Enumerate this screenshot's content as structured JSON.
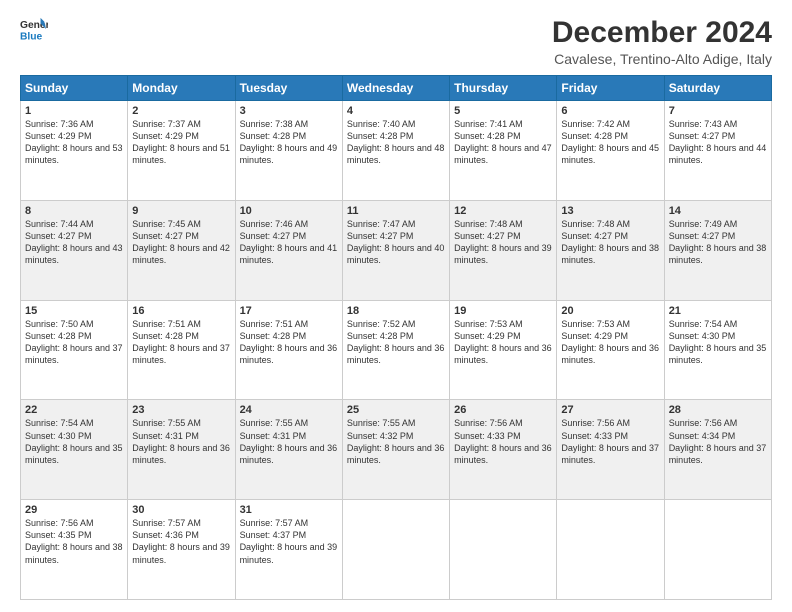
{
  "header": {
    "logo_line1": "General",
    "logo_line2": "Blue",
    "title": "December 2024",
    "subtitle": "Cavalese, Trentino-Alto Adige, Italy"
  },
  "weekdays": [
    "Sunday",
    "Monday",
    "Tuesday",
    "Wednesday",
    "Thursday",
    "Friday",
    "Saturday"
  ],
  "weeks": [
    [
      {
        "day": "1",
        "sunrise": "7:36 AM",
        "sunset": "4:29 PM",
        "daylight": "8 hours and 53 minutes."
      },
      {
        "day": "2",
        "sunrise": "7:37 AM",
        "sunset": "4:29 PM",
        "daylight": "8 hours and 51 minutes."
      },
      {
        "day": "3",
        "sunrise": "7:38 AM",
        "sunset": "4:28 PM",
        "daylight": "8 hours and 49 minutes."
      },
      {
        "day": "4",
        "sunrise": "7:40 AM",
        "sunset": "4:28 PM",
        "daylight": "8 hours and 48 minutes."
      },
      {
        "day": "5",
        "sunrise": "7:41 AM",
        "sunset": "4:28 PM",
        "daylight": "8 hours and 47 minutes."
      },
      {
        "day": "6",
        "sunrise": "7:42 AM",
        "sunset": "4:28 PM",
        "daylight": "8 hours and 45 minutes."
      },
      {
        "day": "7",
        "sunrise": "7:43 AM",
        "sunset": "4:27 PM",
        "daylight": "8 hours and 44 minutes."
      }
    ],
    [
      {
        "day": "8",
        "sunrise": "7:44 AM",
        "sunset": "4:27 PM",
        "daylight": "8 hours and 43 minutes."
      },
      {
        "day": "9",
        "sunrise": "7:45 AM",
        "sunset": "4:27 PM",
        "daylight": "8 hours and 42 minutes."
      },
      {
        "day": "10",
        "sunrise": "7:46 AM",
        "sunset": "4:27 PM",
        "daylight": "8 hours and 41 minutes."
      },
      {
        "day": "11",
        "sunrise": "7:47 AM",
        "sunset": "4:27 PM",
        "daylight": "8 hours and 40 minutes."
      },
      {
        "day": "12",
        "sunrise": "7:48 AM",
        "sunset": "4:27 PM",
        "daylight": "8 hours and 39 minutes."
      },
      {
        "day": "13",
        "sunrise": "7:48 AM",
        "sunset": "4:27 PM",
        "daylight": "8 hours and 38 minutes."
      },
      {
        "day": "14",
        "sunrise": "7:49 AM",
        "sunset": "4:27 PM",
        "daylight": "8 hours and 38 minutes."
      }
    ],
    [
      {
        "day": "15",
        "sunrise": "7:50 AM",
        "sunset": "4:28 PM",
        "daylight": "8 hours and 37 minutes."
      },
      {
        "day": "16",
        "sunrise": "7:51 AM",
        "sunset": "4:28 PM",
        "daylight": "8 hours and 37 minutes."
      },
      {
        "day": "17",
        "sunrise": "7:51 AM",
        "sunset": "4:28 PM",
        "daylight": "8 hours and 36 minutes."
      },
      {
        "day": "18",
        "sunrise": "7:52 AM",
        "sunset": "4:28 PM",
        "daylight": "8 hours and 36 minutes."
      },
      {
        "day": "19",
        "sunrise": "7:53 AM",
        "sunset": "4:29 PM",
        "daylight": "8 hours and 36 minutes."
      },
      {
        "day": "20",
        "sunrise": "7:53 AM",
        "sunset": "4:29 PM",
        "daylight": "8 hours and 36 minutes."
      },
      {
        "day": "21",
        "sunrise": "7:54 AM",
        "sunset": "4:30 PM",
        "daylight": "8 hours and 35 minutes."
      }
    ],
    [
      {
        "day": "22",
        "sunrise": "7:54 AM",
        "sunset": "4:30 PM",
        "daylight": "8 hours and 35 minutes."
      },
      {
        "day": "23",
        "sunrise": "7:55 AM",
        "sunset": "4:31 PM",
        "daylight": "8 hours and 36 minutes."
      },
      {
        "day": "24",
        "sunrise": "7:55 AM",
        "sunset": "4:31 PM",
        "daylight": "8 hours and 36 minutes."
      },
      {
        "day": "25",
        "sunrise": "7:55 AM",
        "sunset": "4:32 PM",
        "daylight": "8 hours and 36 minutes."
      },
      {
        "day": "26",
        "sunrise": "7:56 AM",
        "sunset": "4:33 PM",
        "daylight": "8 hours and 36 minutes."
      },
      {
        "day": "27",
        "sunrise": "7:56 AM",
        "sunset": "4:33 PM",
        "daylight": "8 hours and 37 minutes."
      },
      {
        "day": "28",
        "sunrise": "7:56 AM",
        "sunset": "4:34 PM",
        "daylight": "8 hours and 37 minutes."
      }
    ],
    [
      {
        "day": "29",
        "sunrise": "7:56 AM",
        "sunset": "4:35 PM",
        "daylight": "8 hours and 38 minutes."
      },
      {
        "day": "30",
        "sunrise": "7:57 AM",
        "sunset": "4:36 PM",
        "daylight": "8 hours and 39 minutes."
      },
      {
        "day": "31",
        "sunrise": "7:57 AM",
        "sunset": "4:37 PM",
        "daylight": "8 hours and 39 minutes."
      },
      null,
      null,
      null,
      null
    ]
  ]
}
